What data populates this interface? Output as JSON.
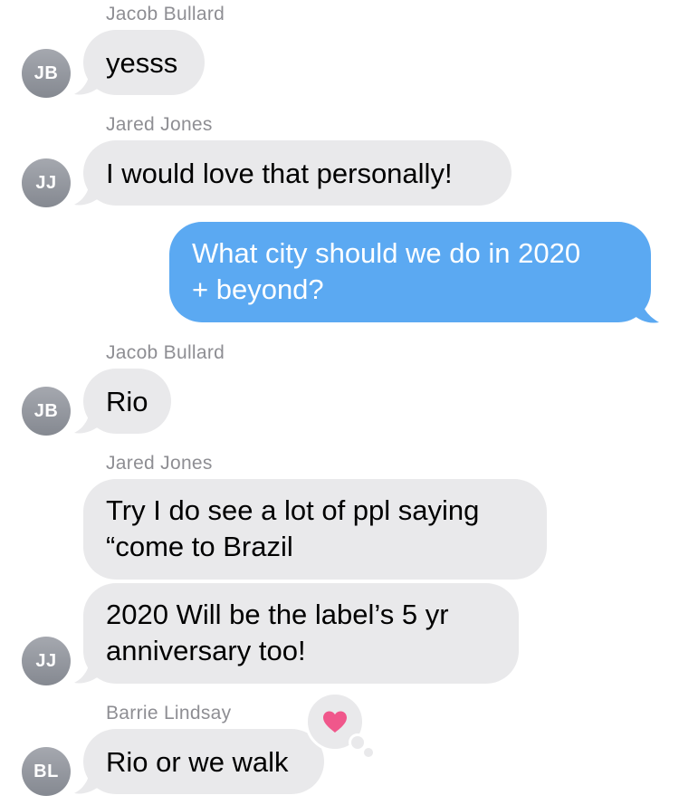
{
  "colors": {
    "incoming_bubble": "#e9e9eb",
    "outgoing_bubble": "#5ba9f2",
    "sender_name": "#8e8e93",
    "avatar": "#8e9198",
    "heart": "#f0578b"
  },
  "messages": [
    {
      "sender": "Jacob Bullard",
      "initials": "JB",
      "text": "yesss"
    },
    {
      "sender": "Jared Jones",
      "initials": "JJ",
      "text": "I would love that personally!"
    },
    {
      "outgoing_line1": "What city should we do in 2020",
      "outgoing_line2": "+ beyond?"
    },
    {
      "sender": "Jacob Bullard",
      "initials": "JB",
      "text": "Rio"
    },
    {
      "sender": "Jared Jones",
      "initials": "JJ",
      "line1": "Try I do see a lot of ppl saying",
      "line2": "“come to Brazil"
    },
    {
      "line1": "2020 Will be the label’s 5 yr",
      "line2": "anniversary too!"
    },
    {
      "sender": "Barrie Lindsay",
      "initials": "BL",
      "text": "Rio or we walk",
      "tapback": "heart-icon"
    }
  ]
}
